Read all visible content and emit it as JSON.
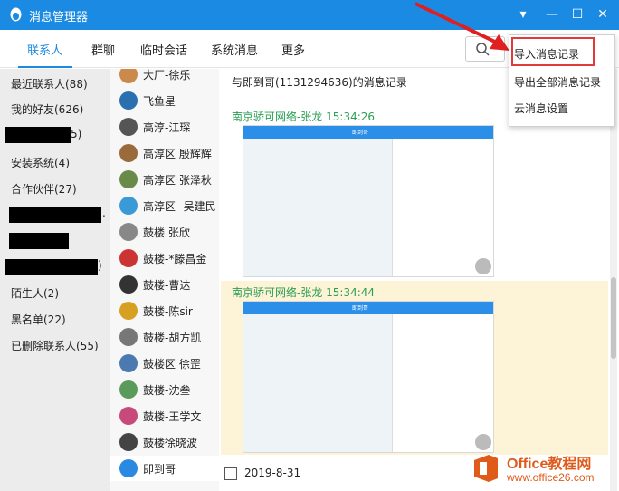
{
  "window": {
    "title": "消息管理器",
    "title_color": "#1a8ae2"
  },
  "tabs": [
    {
      "label": "联系人"
    },
    {
      "label": "群聊"
    },
    {
      "label": "临时会话"
    },
    {
      "label": "系统消息"
    },
    {
      "label": "更多"
    }
  ],
  "groups": [
    {
      "label": "最近联系人(88)"
    },
    {
      "label": "我的好友(626)"
    },
    {
      "label": "5)"
    },
    {
      "label": "安装系统(4)"
    },
    {
      "label": "合作伙伴(27)"
    },
    {
      "label": "."
    },
    {
      "label": ""
    },
    {
      "label": ")"
    },
    {
      "label": "陌生人(2)"
    },
    {
      "label": "黑名单(22)"
    },
    {
      "label": "已删除联系人(55)"
    }
  ],
  "contacts": [
    {
      "name": "大厂-徐乐",
      "color": "#c98a4a"
    },
    {
      "name": "飞鱼星",
      "color": "#2a6fb0"
    },
    {
      "name": "高淳-江琛",
      "color": "#555555"
    },
    {
      "name": "高淳区  殷辉辉",
      "color": "#9a6a3a"
    },
    {
      "name": "高淳区  张泽秋",
      "color": "#6a8a4a"
    },
    {
      "name": "高淳区--吴建民",
      "color": "#3a9ad8"
    },
    {
      "name": "鼓楼  张欣",
      "color": "#888888"
    },
    {
      "name": "鼓楼-*滕昌金",
      "color": "#cc3333"
    },
    {
      "name": "鼓楼-曹达",
      "color": "#333333"
    },
    {
      "name": "鼓楼-陈sir",
      "color": "#d8a020"
    },
    {
      "name": "鼓楼-胡方凯",
      "color": "#777777"
    },
    {
      "name": "鼓楼区  徐罡",
      "color": "#4a7ab0"
    },
    {
      "name": "鼓楼-沈叁",
      "color": "#5a9a5a"
    },
    {
      "name": "鼓楼-王学文",
      "color": "#c84a7a"
    },
    {
      "name": "鼓楼徐晓波",
      "color": "#444444"
    },
    {
      "name": "即到哥",
      "color": "#2a8ae2"
    }
  ],
  "main": {
    "history_title": "与即到哥(1131294636)的消息记录",
    "messages": [
      {
        "sender": "南京骄可网络-张龙  15:34:26",
        "shot_title": "即到哥"
      },
      {
        "sender": "南京骄可网络-张龙  15:34:44",
        "shot_title": "即到哥"
      }
    ],
    "date": "2019-8-31"
  },
  "menu": {
    "items": [
      {
        "label": "导入消息记录"
      },
      {
        "label": "导出全部消息记录"
      },
      {
        "label": "云消息设置"
      }
    ],
    "highlight_color": "#e03a3a"
  },
  "watermark": {
    "brand": "Office教程网",
    "url": "www.office26.com"
  }
}
